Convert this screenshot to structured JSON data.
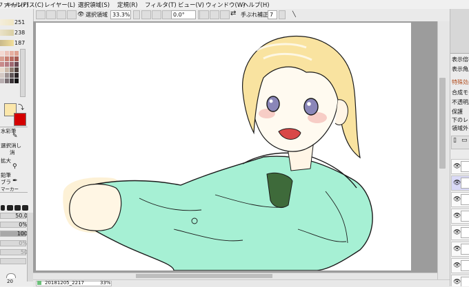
{
  "menu": {
    "items": [
      "ファイル(F)",
      "キャンバス(C)",
      "レイヤー(L)",
      "選択領域(S)",
      "定規(R)",
      "フィルタ(T)",
      "ビュー(V)",
      "ウィンドウ(W)",
      "ヘルプ(H)"
    ]
  },
  "toolbar": {
    "selection_label": "選択領域",
    "zoom_value": "33.3%",
    "angle_value": "0.0°",
    "stabilizer_label": "手ぶれ補正",
    "stabilizer_value": "7"
  },
  "left_panel": {
    "hsv_values": [
      "251",
      "238",
      "187"
    ],
    "tool_labels": [
      "水彩筆",
      "選択消し",
      "消",
      "拡大",
      "鉛筆",
      "ブラ",
      "マーカー"
    ],
    "brush_size": "50.0",
    "min_size": "0%",
    "density": "100",
    "extra_values": [
      "0%",
      "50",
      "20"
    ],
    "colors": {
      "main": "#fbe7ab",
      "sub": "#d40000"
    }
  },
  "right_panel": {
    "labels": [
      "表示倍率",
      "表示角度",
      "特殊効果",
      "合成モード",
      "不透明度",
      "保護",
      "下のレ",
      "領域外"
    ]
  },
  "status": {
    "file_name": "20181205_2217",
    "zoom": "33%"
  }
}
